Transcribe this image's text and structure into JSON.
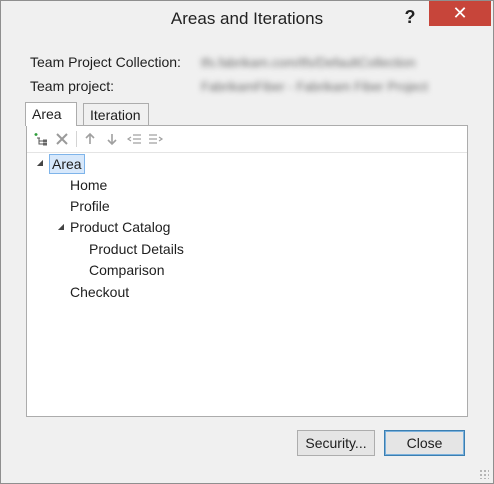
{
  "window": {
    "title": "Areas and Iterations",
    "help_label": "?",
    "close_label": "✕"
  },
  "fields": {
    "collection_label": "Team Project Collection:",
    "collection_value": "tfs.fabrikam.com/tfs/DefaultCollection",
    "project_label": "Team project:",
    "project_value": "FabrikamFiber - Fabrikam Fiber Project"
  },
  "tabs": [
    {
      "label": "Area",
      "active": true
    },
    {
      "label": "Iteration",
      "active": false
    }
  ],
  "toolbar": {
    "icons": [
      "add-child-icon",
      "delete-icon",
      "move-up-icon",
      "move-down-icon",
      "outdent-icon",
      "indent-icon"
    ]
  },
  "tree": {
    "root": {
      "label": "Area",
      "expanded": true,
      "selected": true
    },
    "items": [
      {
        "label": "Home"
      },
      {
        "label": "Profile"
      },
      {
        "label": "Product Catalog",
        "expanded": true
      },
      {
        "label": "Product Details"
      },
      {
        "label": "Comparison"
      },
      {
        "label": "Checkout"
      }
    ]
  },
  "buttons": {
    "security_label": "Security...",
    "close_label": "Close"
  }
}
